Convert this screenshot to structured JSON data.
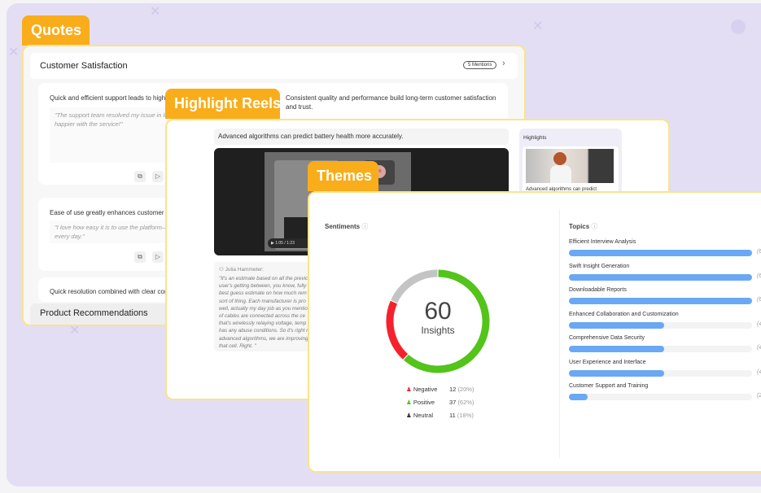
{
  "quotes": {
    "tab_label": "Quotes",
    "section_title": "Customer Satisfaction",
    "mentions_badge": "5 Mentions",
    "items": [
      {
        "title": "Quick and efficient support leads to high cu",
        "quote": "\"The support team resolved my issue in les",
        "quote2": "happier with the service!\""
      },
      {
        "title": "Ease of use greatly enhances customer sati",
        "quote": "\"I love how easy it is to use the platform—i",
        "quote2": "every day.\""
      },
      {
        "title": "Quick resolution combined with clear comr"
      }
    ],
    "side_item": {
      "title": "Consistent quality and performance build long-term customer satisfaction",
      "title2": "and trust."
    },
    "next_section": "Product Recommendations"
  },
  "highlight_reels": {
    "tab_label": "Highlight Reels",
    "headline": "Advanced algorithms can predict battery health more accurately.",
    "video_time": "1:05 / 1:23",
    "avatar_initials": "JK",
    "speaker": "Julia Hammeter:",
    "transcript": [
      "\"It's an estimate based on all the previc",
      "user's getting between, you know, fully",
      "best guess estimate on how much rem",
      "sort of thing. Each manufacturer is pro",
      "well, actually my day job as you mentio",
      "of cables are connected across the ce",
      "that's wirelessly relaying voltage, temp",
      "has any abuse conditions. So it's right r",
      "advanced algorithms, we are improving",
      "that cell. Right. \""
    ],
    "highlights_title": "Highlights",
    "highlight_caption": "Advanced algorithms can predict"
  },
  "themes": {
    "tab_label": "Themes",
    "sentiments_title": "Sentiments",
    "total": "60",
    "total_label": "Insights",
    "topics_title": "Topics",
    "topics": [
      {
        "label": "Efficient Interview Analysis",
        "fill_pct": 100,
        "count": "(6"
      },
      {
        "label": "Swift Insight Generation",
        "fill_pct": 100,
        "count": "(6"
      },
      {
        "label": "Downloadable Reports",
        "fill_pct": 100,
        "count": "(6"
      },
      {
        "label": "Enhanced Collaboration and Customization",
        "fill_pct": 52,
        "count": "(4"
      },
      {
        "label": "Comprehensive Data Security",
        "fill_pct": 52,
        "count": "(4"
      },
      {
        "label": "User Experience and Interface",
        "fill_pct": 52,
        "count": "(4"
      },
      {
        "label": "Customer Support and Training",
        "fill_pct": 10,
        "count": "(2"
      }
    ]
  },
  "chart_data": {
    "type": "pie",
    "categories": [
      "Positive",
      "Negative",
      "Neutral"
    ],
    "values": [
      37,
      12,
      11
    ],
    "percent_labels": [
      "(62%)",
      "(20%)",
      "(18%)"
    ],
    "colors": [
      "#52c41a",
      "#f5222d",
      "#c4c4c4"
    ],
    "legend": [
      {
        "name": "Negative",
        "count": "12",
        "pct": "(20%)",
        "color": "#f5222d"
      },
      {
        "name": "Positive",
        "count": "37",
        "pct": "(62%)",
        "color": "#52c41a"
      },
      {
        "name": "Neutral",
        "count": "11",
        "pct": "(18%)",
        "color": "#333333"
      }
    ]
  },
  "colors": {
    "accent": "#f9ad1a",
    "card_border": "#fbe38a",
    "background": "#e3def4",
    "bar": "#6aa8f5"
  }
}
